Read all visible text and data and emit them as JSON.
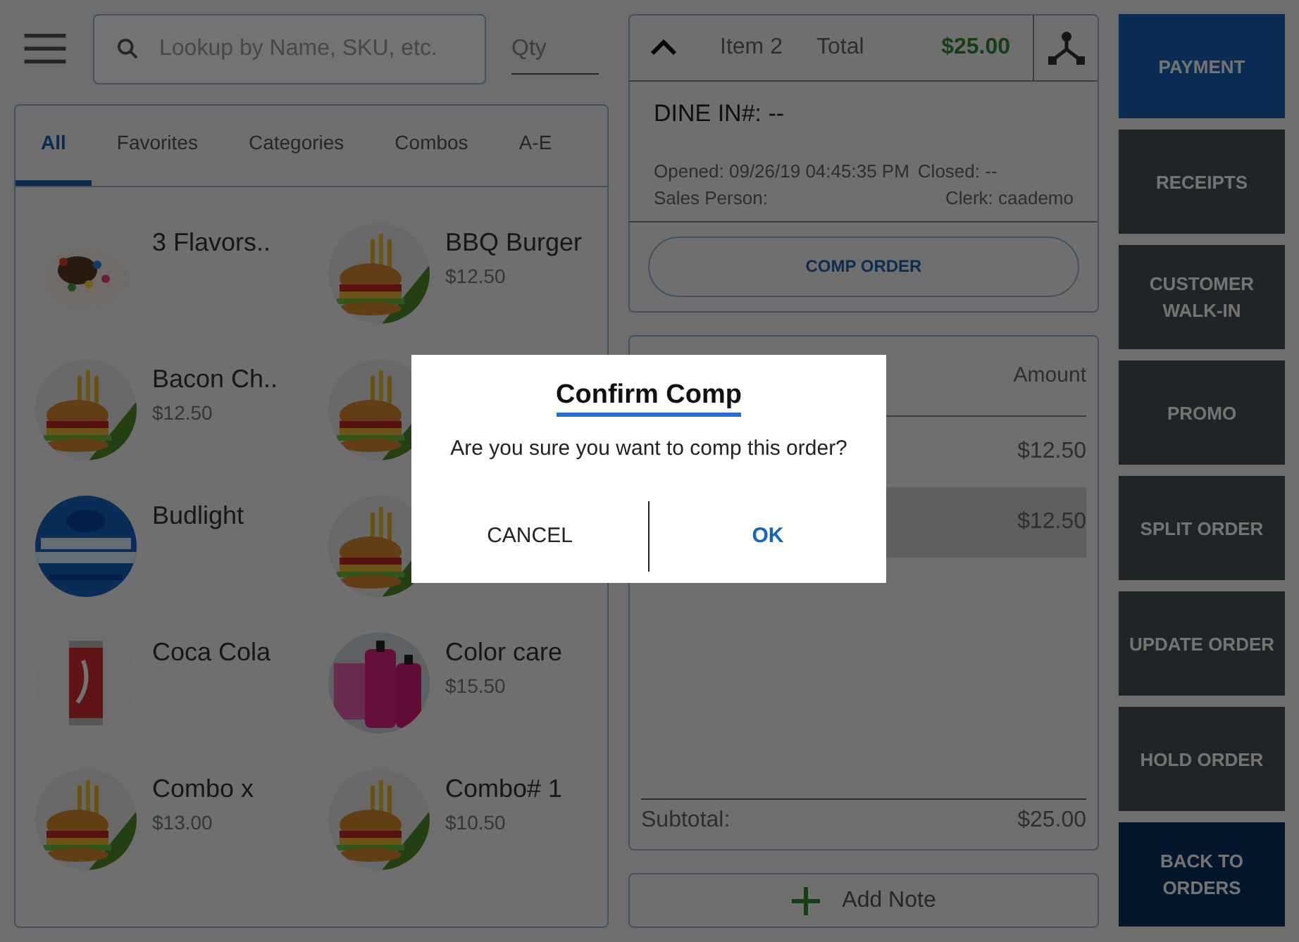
{
  "search": {
    "placeholder": "Lookup by Name, SKU, etc."
  },
  "qty": {
    "placeholder": "Qty"
  },
  "tabs": [
    {
      "label": "All",
      "selected": true
    },
    {
      "label": "Favorites",
      "selected": false
    },
    {
      "label": "Categories",
      "selected": false
    },
    {
      "label": "Combos",
      "selected": false
    },
    {
      "label": "A-E",
      "selected": false
    }
  ],
  "products": [
    {
      "kind": "item",
      "name": "3 Flavors.."
    },
    {
      "kind": "item",
      "name": "BBQ Burger",
      "price": "$12.50"
    },
    {
      "kind": "item",
      "name": "Bacon Ch..",
      "price": "$12.50"
    },
    {
      "kind": "picture"
    },
    {
      "kind": "item",
      "name": "Budlight"
    },
    {
      "kind": "picture"
    },
    {
      "kind": "item",
      "name": "Coca Cola"
    },
    {
      "kind": "item",
      "name": "Color care",
      "price": "$15.50"
    },
    {
      "kind": "item",
      "name": "Combo x",
      "price": "$13.00"
    },
    {
      "kind": "item",
      "name": "Combo# 1",
      "price": "$10.50"
    }
  ],
  "order": {
    "item_label": "Item",
    "item_count": "2",
    "total_label": "Total",
    "total": "$25.00",
    "dine_in": "DINE IN#: --",
    "opened": "Opened: 09/26/19 04:45:35 PM",
    "closed": "Closed: --",
    "sales_person": "Sales Person:",
    "clerk": "Clerk: caademo",
    "comp_button": "COMP ORDER"
  },
  "lines": {
    "amount_header": "Amount",
    "rows": [
      {
        "amount": "$12.50",
        "selected": false
      },
      {
        "amount": "$12.50",
        "selected": true
      }
    ],
    "subtotal_label": "Subtotal:",
    "subtotal": "$25.00"
  },
  "add_note": "Add Note",
  "actions": [
    {
      "label": "PAYMENT",
      "kind": "primary"
    },
    {
      "label": "RECEIPTS",
      "kind": "normal"
    },
    {
      "label": "CUSTOMER WALK-IN",
      "kind": "normal"
    },
    {
      "label": "PROMO",
      "kind": "normal"
    },
    {
      "label": "SPLIT ORDER",
      "kind": "normal"
    },
    {
      "label": "UPDATE ORDER",
      "kind": "normal"
    },
    {
      "label": "HOLD ORDER",
      "kind": "normal"
    },
    {
      "label": "BACK TO ORDERS",
      "kind": "dark"
    }
  ],
  "dialog": {
    "title": "Confirm Comp",
    "message": "Are you sure you want to comp this order?",
    "cancel": "CANCEL",
    "ok": "OK"
  }
}
